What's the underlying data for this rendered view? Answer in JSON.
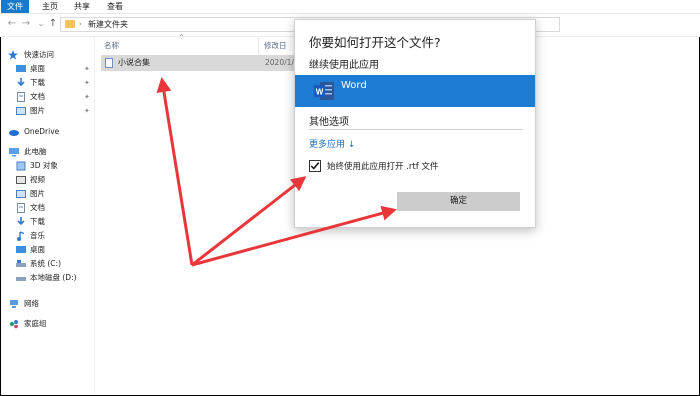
{
  "ribbon": {
    "tabs": [
      "文件",
      "主页",
      "共享",
      "查看"
    ]
  },
  "address": {
    "breadcrumb_sep": "›",
    "path": "新建文件夹"
  },
  "sidebar": {
    "items": [
      {
        "label": "快速访问",
        "icon": "star-icon"
      },
      {
        "label": "桌面",
        "icon": "desktop-icon",
        "pinned": true
      },
      {
        "label": "下载",
        "icon": "download-icon",
        "pinned": true
      },
      {
        "label": "文档",
        "icon": "document-icon",
        "pinned": true
      },
      {
        "label": "图片",
        "icon": "pictures-icon",
        "pinned": true
      },
      {
        "label": "OneDrive",
        "icon": "cloud-icon"
      },
      {
        "label": "此电脑",
        "icon": "computer-icon"
      },
      {
        "label": "3D 对象",
        "icon": "cube-icon"
      },
      {
        "label": "视频",
        "icon": "video-icon"
      },
      {
        "label": "图片",
        "icon": "pictures-icon"
      },
      {
        "label": "文档",
        "icon": "document-icon"
      },
      {
        "label": "下载",
        "icon": "download-icon"
      },
      {
        "label": "音乐",
        "icon": "music-icon"
      },
      {
        "label": "桌面",
        "icon": "desktop-icon"
      },
      {
        "label": "系统 (C:)",
        "icon": "drive-icon"
      },
      {
        "label": "本地磁盘 (D:)",
        "icon": "drive-icon"
      },
      {
        "label": "网络",
        "icon": "network-icon"
      },
      {
        "label": "家庭组",
        "icon": "homegroup-icon"
      }
    ]
  },
  "list": {
    "col_name": "名称",
    "col_date": "修改日",
    "files": [
      {
        "name": "小说合集",
        "date": "2020/1/"
      }
    ]
  },
  "dialog": {
    "title": "你要如何打开这个文件?",
    "subtitle": "继续使用此应用",
    "app": "Word",
    "other": "其他选项",
    "more_apps": "更多应用 ↓",
    "always_use": "始终使用此应用打开 .rtf 文件",
    "always_checked": true,
    "ok": "确定"
  },
  "colors": {
    "accent": "#1e7bd4",
    "ribbon_file": "#1979ca",
    "arrow": "#e8363a"
  }
}
